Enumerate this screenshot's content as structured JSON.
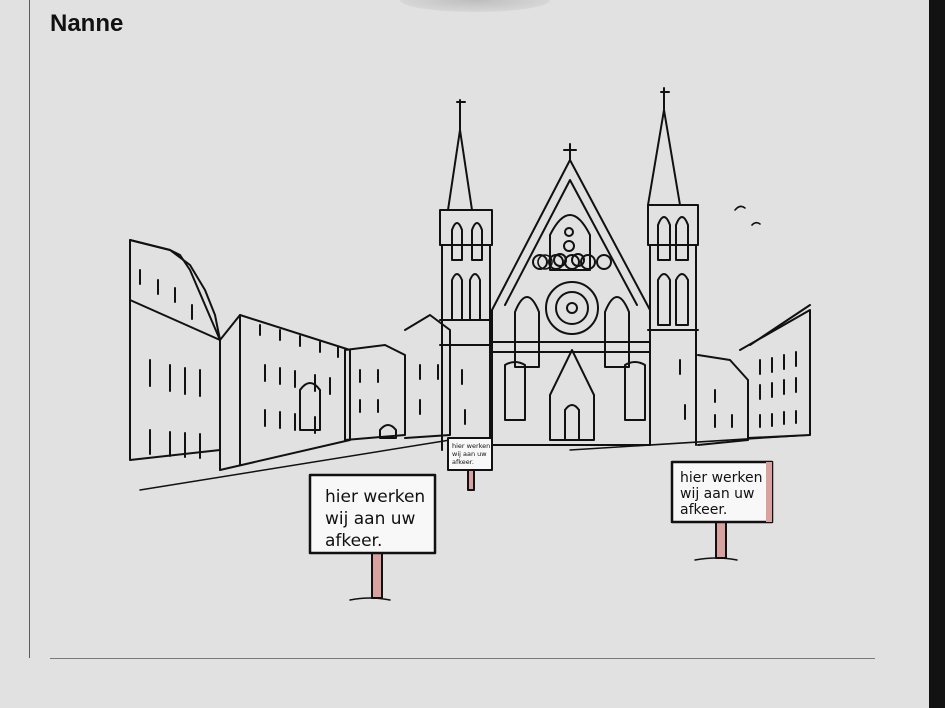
{
  "post": {
    "author": "Nanne"
  },
  "illustration": {
    "signs": {
      "left": [
        "hier werken",
        "wij aan uw",
        "afkeer."
      ],
      "center": [
        "hier werken",
        "wij aan uw",
        "afkeer."
      ],
      "right": [
        "hier werken",
        "wij aan uw",
        "afkeer."
      ]
    }
  },
  "colors": {
    "background": "#e1e1e1",
    "ink": "#111111",
    "sign_post": "#d9a1a0"
  }
}
